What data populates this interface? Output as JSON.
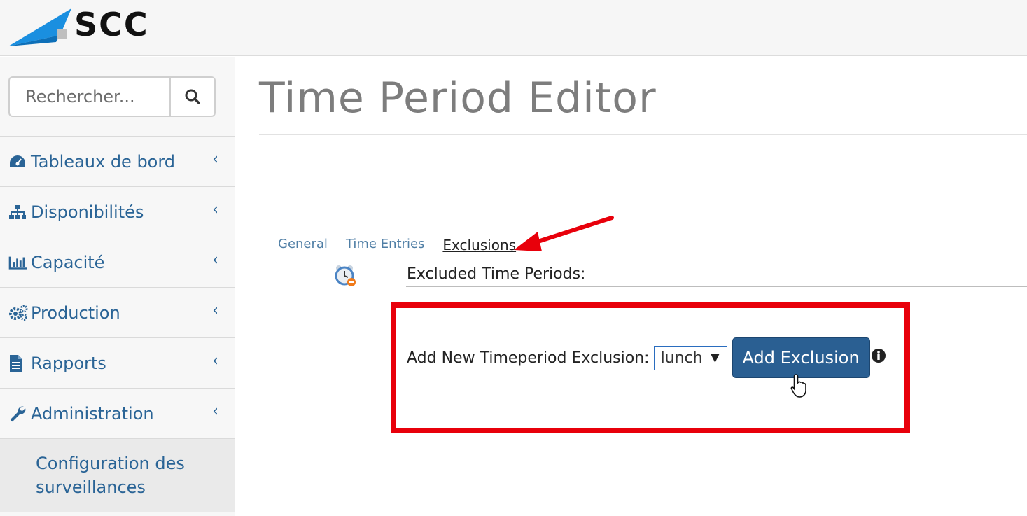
{
  "brand": {
    "name": "SCC",
    "accent": "#1a8fe0"
  },
  "search": {
    "placeholder": "Rechercher...",
    "icon": "search-icon"
  },
  "sidebar": {
    "items": [
      {
        "label": "Tableaux de bord",
        "icon": "dashboard-icon"
      },
      {
        "label": "Disponibilités",
        "icon": "sitemap-icon"
      },
      {
        "label": "Capacité",
        "icon": "bar-chart-icon"
      },
      {
        "label": "Production",
        "icon": "gears-icon"
      },
      {
        "label": "Rapports",
        "icon": "file-icon"
      },
      {
        "label": "Administration",
        "icon": "wrench-icon"
      }
    ],
    "subitem": {
      "label": "Configuration des surveillances"
    },
    "chevron": "‹"
  },
  "page": {
    "title": "Time Period Editor"
  },
  "tabs": [
    {
      "label": "General"
    },
    {
      "label": "Time Entries"
    },
    {
      "label": "Exclusions",
      "active": true
    }
  ],
  "exclusions": {
    "section_title": "Excluded Time Periods:",
    "add_label": "Add New Timeperiod Exclusion:",
    "selected_option": "lunch",
    "button_label": "Add Exclusion"
  },
  "colors": {
    "link": "#2a6496",
    "button": "#2a5f92",
    "highlight": "#e8000b"
  }
}
